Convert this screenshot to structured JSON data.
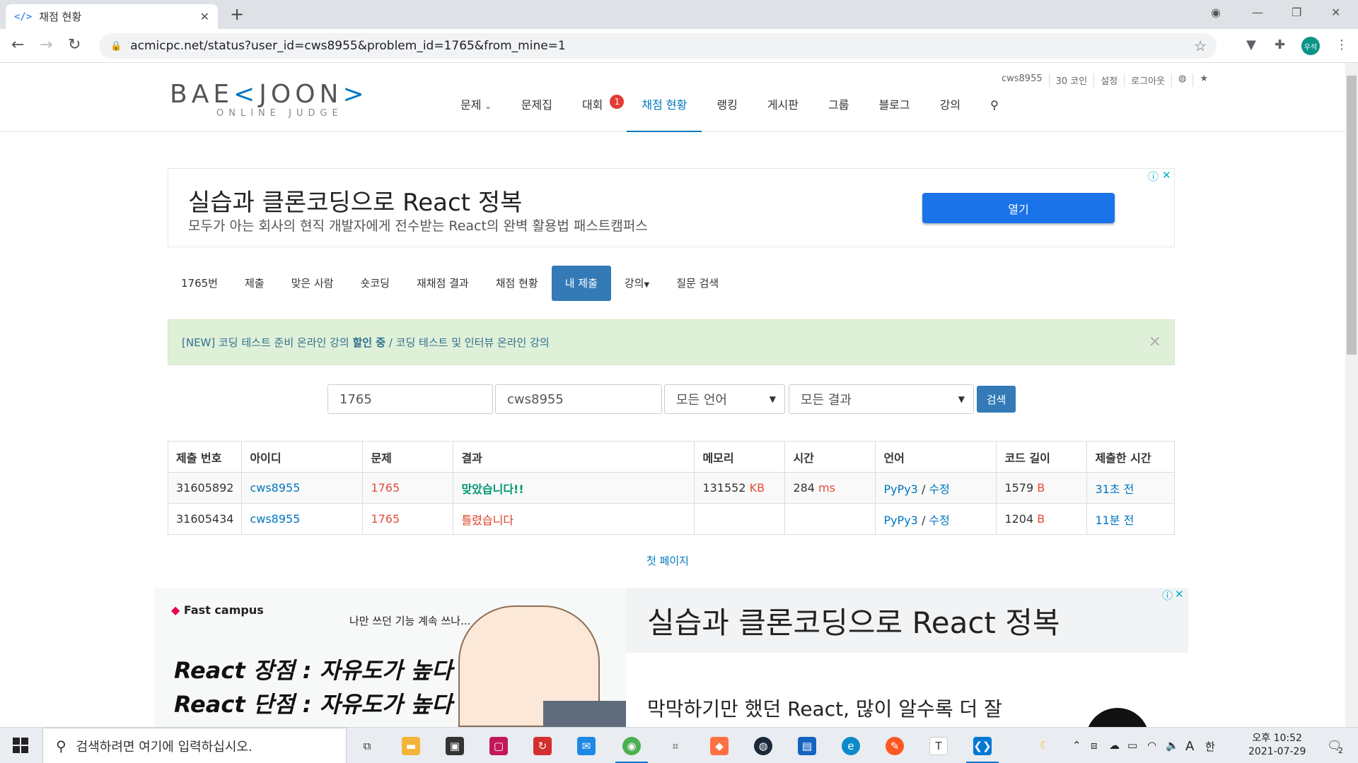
{
  "browser": {
    "tab_title": "채점 현황",
    "tab_favicon": "</>",
    "url": "acmicpc.net/status?user_id=cws8955&problem_id=1765&from_mine=1",
    "profile_label": "우석"
  },
  "site": {
    "logo": "BAEKJOON",
    "logo_sub": "ONLINE JUDGE",
    "top_menu": [
      "cws8955",
      "30 코인",
      "설정",
      "로그아웃"
    ],
    "nav": [
      "문제",
      "문제집",
      "대회",
      "채점 현황",
      "랭킹",
      "게시판",
      "그룹",
      "블로그",
      "강의"
    ],
    "contest_badge": "1"
  },
  "ad_top": {
    "title": "실습과 클론코딩으로 React 정복",
    "subtitle": "모두가 아는 회사의 현직 개발자에게 전수받는 React의 완벽 활용법 패스트캠퍼스",
    "button": "열기"
  },
  "problem_tabs": [
    "1765번",
    "제출",
    "맞은 사람",
    "숏코딩",
    "재채점 결과",
    "채점 현황",
    "내 제출",
    "강의",
    "질문 검색"
  ],
  "alert": {
    "prefix": "[NEW] 코딩 테스트 준비 온라인 강의 ",
    "strong": "할인 중",
    "suffix": " / 코딩 테스트 및 인터뷰 온라인 강의",
    "close": "×"
  },
  "search": {
    "problem_id": "1765",
    "user_id": "cws8955",
    "language": "모든 언어",
    "result": "모든 결과",
    "button": "검색"
  },
  "table": {
    "headers": [
      "제출 번호",
      "아이디",
      "문제",
      "결과",
      "메모리",
      "시간",
      "언어",
      "코드 길이",
      "제출한 시간"
    ],
    "rows": [
      {
        "id": "31605892",
        "user": "cws8955",
        "problem": "1765",
        "result": "맞았습니다!!",
        "memory": "131552",
        "memory_unit": "KB",
        "time": "284",
        "time_unit": "ms",
        "lang": "PyPy3",
        "edit": "수정",
        "length": "1579",
        "length_unit": "B",
        "when": "31초 전"
      },
      {
        "id": "31605434",
        "user": "cws8955",
        "problem": "1765",
        "result": "틀렸습니다",
        "memory": "",
        "memory_unit": "",
        "time": "",
        "time_unit": "",
        "lang": "PyPy3",
        "edit": "수정",
        "length": "1204",
        "length_unit": "B",
        "when": "11분 전"
      }
    ]
  },
  "pagination": {
    "first": "첫 페이지"
  },
  "ad_bottom": {
    "brand": "Fast campus",
    "caption": "나만 쓰던 기능 계속 쓰나...",
    "line1": "React 장점 : 자유도가 높다",
    "line2": "React 단점 : 자유도가 높다",
    "title": "실습과 클론코딩으로 React 정복",
    "body": "막막하기만 했던 React, 많이 알수록 더 잘"
  },
  "taskbar": {
    "search_placeholder": "검색하려면 여기에 입력하십시오.",
    "ime": "한",
    "time": "오후 10:52",
    "date": "2021-07-29",
    "notifications": "2"
  },
  "colors": {
    "accent": "#0076c0",
    "primary_button": "#337ab7",
    "accepted": "#009874",
    "wrong": "#dd4124"
  }
}
